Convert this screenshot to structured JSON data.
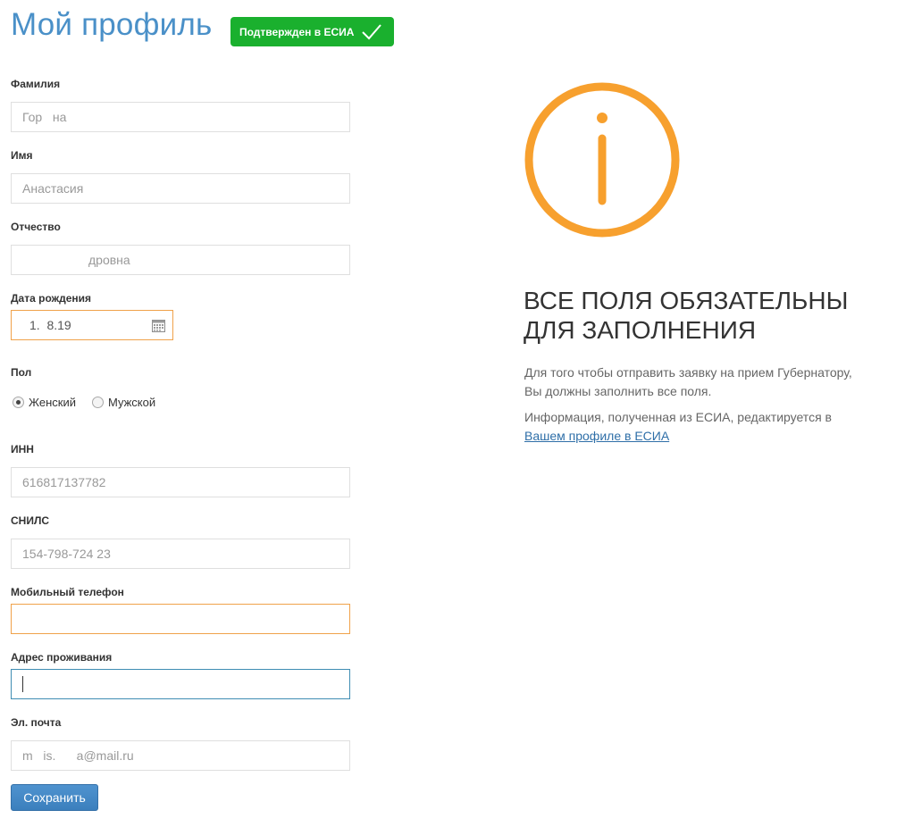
{
  "header": {
    "title": "Мой профиль",
    "badge_label": "Подтвержден в ЕСИА"
  },
  "form": {
    "surname": {
      "label": "Фамилия",
      "value": "Гор   на"
    },
    "name": {
      "label": "Имя",
      "value": "Анастасия"
    },
    "patronymic": {
      "label": "Отчество",
      "value": "дровна"
    },
    "birth_date": {
      "label": "Дата рождения",
      "value": "1.  8.19"
    },
    "gender": {
      "label": "Пол",
      "options": [
        "Женский",
        "Мужской"
      ],
      "selected": "Женский"
    },
    "inn": {
      "label": "ИНН",
      "value": "616817137782"
    },
    "snils": {
      "label": "СНИЛС",
      "value": "154-798-724 23"
    },
    "phone": {
      "label": "Мобильный телефон",
      "value": ""
    },
    "address": {
      "label": "Адрес проживания",
      "value": ""
    },
    "email": {
      "label": "Эл. почта",
      "value": "m   is.      a@mail.ru"
    },
    "save_label": "Сохранить"
  },
  "info_panel": {
    "heading_line1": "ВСЕ ПОЛЯ ОБЯЗАТЕЛЬНЫ",
    "heading_line2": "ДЛЯ ЗАПОЛНЕНИЯ",
    "text1_line1": "Для того чтобы отправить заявку на прием Губернатору,",
    "text1_line2": "Вы должны заполнить все поля.",
    "text2": "Информация, полученная из ЕСИА, редактируется в",
    "link": "Вашем профиле в ЕСИА"
  },
  "colors": {
    "title_blue": "#4a90c8",
    "badge_green": "#1ab02e",
    "info_orange": "#f7a02e",
    "required_border": "#f0a24a",
    "focus_border": "#3f8db3",
    "button_blue": "#4283c4"
  }
}
